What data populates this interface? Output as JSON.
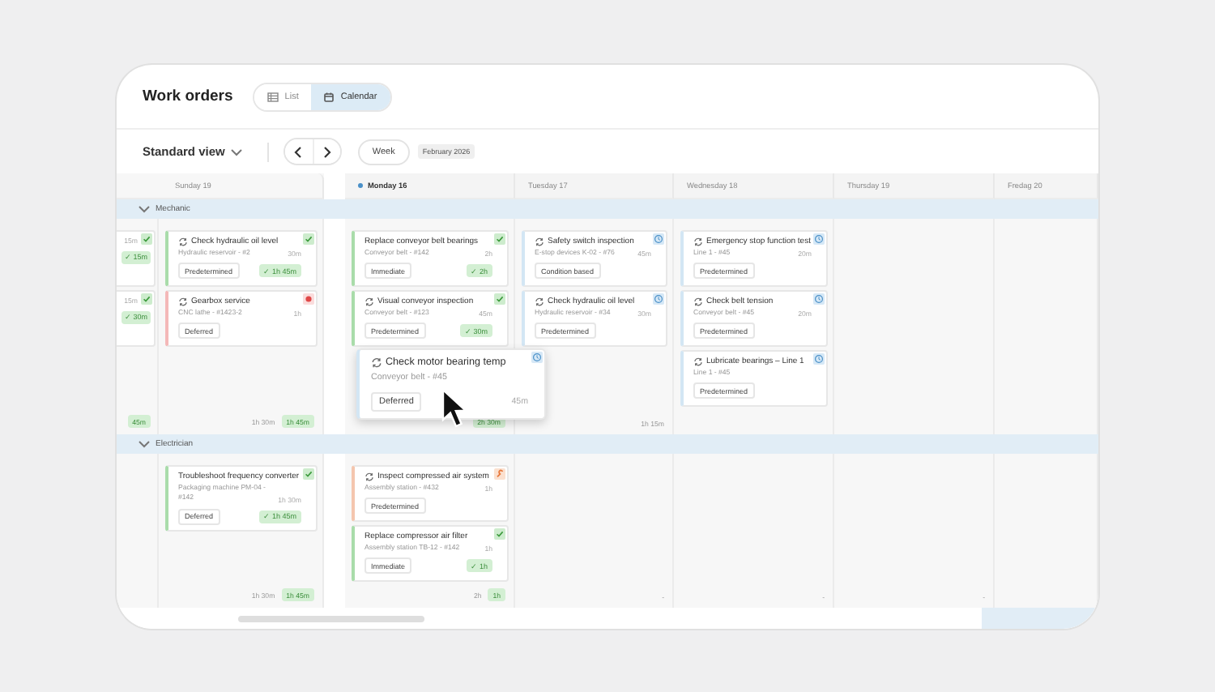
{
  "title": "Work orders",
  "view_toggle": [
    {
      "label": "List",
      "kind": "list",
      "selected": false
    },
    {
      "label": "Calendar",
      "kind": "calendar",
      "selected": true
    }
  ],
  "toolbar": {
    "view": "Standard view",
    "range": "Week",
    "month": "February 2026"
  },
  "days": [
    {
      "label": "Sunday 19",
      "today": false
    },
    {
      "label": "Monday 16",
      "today": true
    },
    {
      "label": "Tuesday 17",
      "today": false
    },
    {
      "label": "Wednesday 18",
      "today": false
    },
    {
      "label": "Thursday 19",
      "today": false
    },
    {
      "label": "Fredag 20",
      "today": false
    }
  ],
  "groups": [
    {
      "name": "Mechanic",
      "expanded": true,
      "cells": [
        {
          "cards": [
            {
              "kind": "done",
              "duration": "15m",
              "badge": "✓ 15m"
            },
            {
              "kind": "done",
              "duration": "15m",
              "badge": "✓ 30m"
            }
          ],
          "footer": {
            "badge": "45m"
          }
        },
        {
          "cards": [
            {
              "kind": "done",
              "recurring": true,
              "title": "Check hydraulic oil level",
              "subtitle": "Hydraulic reservoir - #2",
              "duration": "30m",
              "tag": "Predetermined",
              "badge": "✓ 1h 45m"
            },
            {
              "kind": "overdue",
              "recurring": true,
              "title": "Gearbox service",
              "subtitle": "CNC lathe - #1423-2",
              "duration": "1h",
              "tag": "Deferred"
            }
          ],
          "footer": {
            "text": "1h 30m",
            "badge": "1h 45m"
          }
        },
        {
          "cards": [
            {
              "kind": "done",
              "recurring": false,
              "title": "Replace conveyor belt bearings",
              "subtitle": "Conveyor belt - #142",
              "duration": "2h",
              "tag": "Immediate",
              "badge": "✓ 2h"
            },
            {
              "kind": "done",
              "recurring": true,
              "title": "Visual conveyor inspection",
              "subtitle": "Conveyor belt - #123",
              "duration": "45m",
              "tag": "Predetermined",
              "badge": "✓ 30m"
            }
          ],
          "footer": {
            "badge": "2h 30m"
          }
        },
        {
          "cards": [
            {
              "kind": "scheduled",
              "recurring": true,
              "title": "Safety switch inspection",
              "subtitle": "E-stop devices K-02 - #76",
              "duration": "45m",
              "tag": "Condition based"
            },
            {
              "kind": "scheduled",
              "recurring": true,
              "title": "Check hydraulic oil level",
              "subtitle": "Hydraulic reservoir - #34",
              "duration": "30m",
              "tag": "Predetermined"
            }
          ],
          "footer": {
            "text": "1h 15m"
          }
        },
        {
          "cards": [
            {
              "kind": "scheduled",
              "recurring": true,
              "title": "Emergency stop function test",
              "subtitle": "Line 1 - #45",
              "duration": "20m",
              "tag": "Predetermined"
            },
            {
              "kind": "scheduled",
              "recurring": true,
              "title": "Check belt tension",
              "subtitle": "Conveyor belt - #45",
              "duration": "20m",
              "tag": "Predetermined"
            },
            {
              "kind": "scheduled",
              "recurring": true,
              "title": "Lubricate bearings – Line 1",
              "subtitle": "Line 1 - #45",
              "tag": "Predetermined"
            }
          ]
        },
        {},
        {}
      ],
      "dragged": {
        "kind": "scheduled",
        "recurring": true,
        "title": "Check motor bearing temp",
        "subtitle": "Conveyor belt - #45",
        "duration": "45m",
        "tag": "Deferred"
      }
    },
    {
      "name": "Electrician",
      "expanded": true,
      "cells": [
        {},
        {
          "cards": [
            {
              "kind": "done",
              "recurring": false,
              "title": "Troubleshoot frequency converter",
              "subtitle": "Packaging machine PM-04 - #142",
              "duration": "1h 30m",
              "tag": "Deferred",
              "badge": "✓ 1h 45m"
            }
          ],
          "footer": {
            "text": "1h 30m",
            "badge": "1h 45m"
          }
        },
        {
          "cards": [
            {
              "kind": "issue",
              "recurring": true,
              "title": "Inspect compressed air system",
              "subtitle": "Assembly station - #432",
              "duration": "1h",
              "tag": "Predetermined"
            },
            {
              "kind": "done",
              "recurring": false,
              "title": "Replace compressor air filter",
              "subtitle": "Assembly station TB-12 - #142",
              "duration": "1h",
              "tag": "Immediate",
              "badge": "✓ 1h"
            }
          ],
          "footer": {
            "text": "2h",
            "badge": "1h"
          }
        },
        {
          "footer": {
            "text": "-"
          }
        },
        {
          "footer": {
            "text": "-"
          }
        },
        {
          "footer": {
            "text": "-"
          }
        },
        {}
      ]
    }
  ]
}
